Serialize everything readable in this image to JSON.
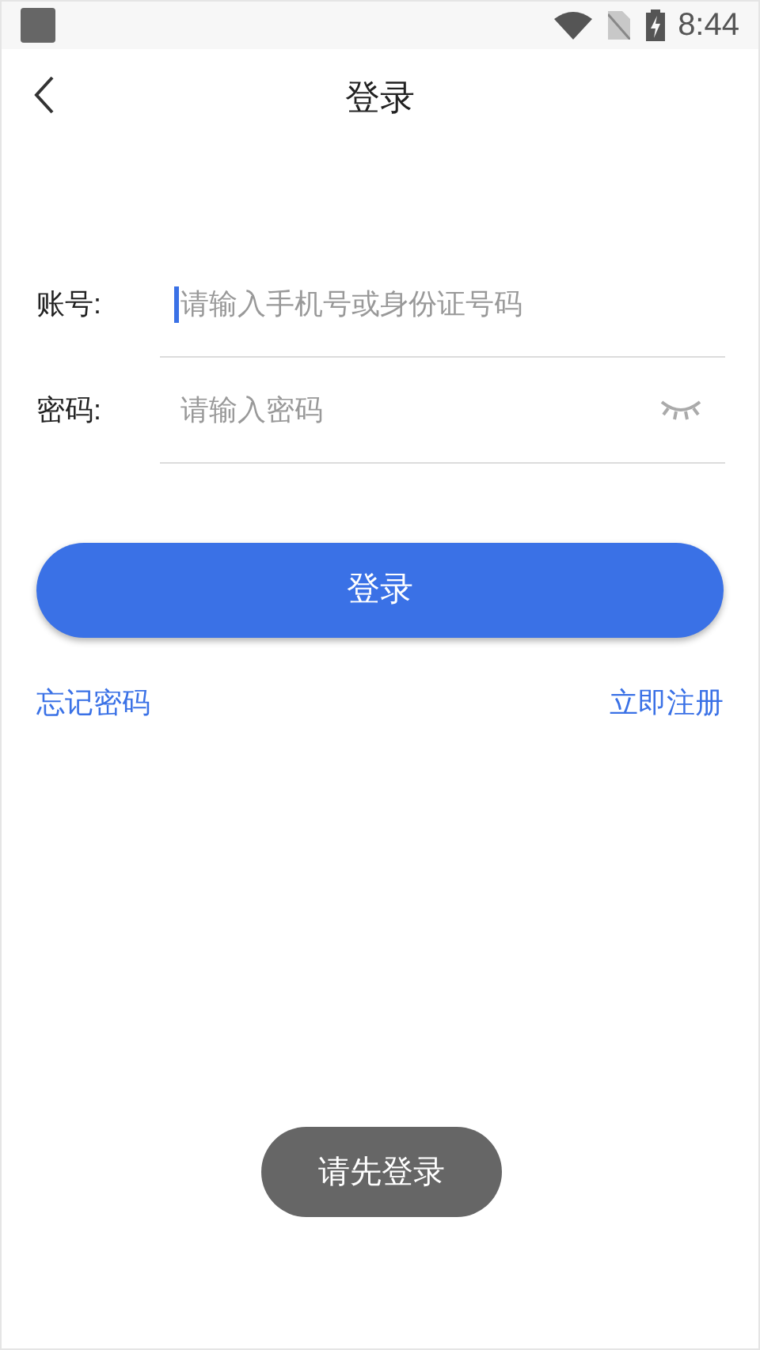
{
  "status_bar": {
    "time": "8:44"
  },
  "header": {
    "title": "登录"
  },
  "fields": [
    {
      "kind": "text",
      "label": "账号:",
      "placeholder": "请输入手机号或身份证号码",
      "focused": true
    },
    {
      "kind": "password",
      "label": "密码:",
      "placeholder": "请输入密码",
      "focused": false
    }
  ],
  "login_button": {
    "label": "登录"
  },
  "links": {
    "forgot": "忘记密码",
    "register": "立即注册"
  },
  "toast": {
    "text": "请先登录"
  }
}
